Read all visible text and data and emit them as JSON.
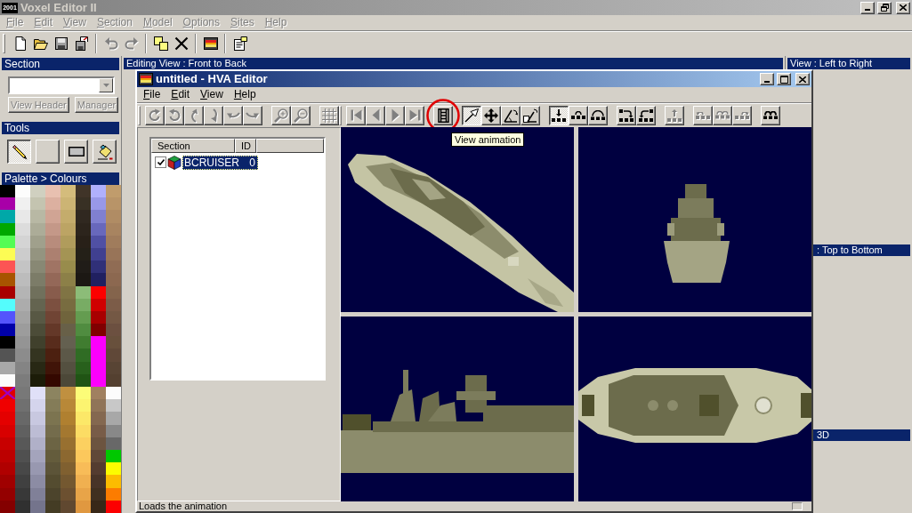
{
  "window": {
    "icon_text": "2001",
    "title": "Voxel Editor II"
  },
  "menu": [
    {
      "label": "File",
      "disabled": true
    },
    {
      "label": "Edit",
      "disabled": true
    },
    {
      "label": "View",
      "disabled": true
    },
    {
      "label": "Section",
      "disabled": true
    },
    {
      "label": "Model",
      "disabled": true
    },
    {
      "label": "Options",
      "disabled": true
    },
    {
      "label": "Sites",
      "disabled": true
    },
    {
      "label": "Help",
      "disabled": true
    }
  ],
  "toolbar": [
    {
      "kind": "new",
      "disabled": false
    },
    {
      "kind": "open",
      "disabled": false
    },
    {
      "kind": "save",
      "disabled": false
    },
    {
      "kind": "save_as",
      "disabled": false
    },
    {
      "kind": "separator"
    },
    {
      "kind": "undo",
      "disabled": true
    },
    {
      "kind": "redo",
      "disabled": true
    },
    {
      "kind": "separator"
    },
    {
      "kind": "copy",
      "disabled": false
    },
    {
      "kind": "delete",
      "disabled": false
    },
    {
      "kind": "separator"
    },
    {
      "kind": "hva",
      "disabled": false
    },
    {
      "kind": "separator"
    },
    {
      "kind": "properties",
      "disabled": false
    }
  ],
  "section_panel": {
    "title": "Section",
    "buttons": [
      {
        "label": "View Header",
        "disabled": true
      },
      {
        "label": "Manager",
        "disabled": true
      }
    ]
  },
  "tools_panel": {
    "title": "Tools",
    "tools": [
      {
        "kind": "pencil",
        "selected": true
      },
      {
        "kind": "blank",
        "selected": false
      },
      {
        "kind": "rectangle",
        "selected": false
      },
      {
        "kind": "fill",
        "selected": false
      }
    ]
  },
  "palette": {
    "title": "Palette > Colours",
    "columns": [
      [
        {
          "color": "#000000",
          "selected": false
        },
        {
          "color": "#a800a8",
          "selected": false
        },
        {
          "color": "#00a8a8",
          "selected": false
        },
        {
          "color": "#00a800",
          "selected": false
        },
        {
          "color": "#54fc54",
          "selected": false
        },
        {
          "color": "#fcfc54",
          "selected": false
        },
        {
          "color": "#fc5454",
          "selected": false
        },
        {
          "color": "#a85400",
          "selected": false
        },
        {
          "color": "#a80000",
          "selected": false
        },
        {
          "color": "#54fcfc",
          "selected": false
        },
        {
          "color": "#5454fc",
          "selected": false
        },
        {
          "color": "#0000a8",
          "selected": false
        },
        {
          "color": "#000000",
          "selected": false
        },
        {
          "color": "#545454",
          "selected": false
        },
        {
          "color": "#a8a8a8",
          "selected": false
        },
        {
          "color": "#fcfcfc",
          "selected": false
        },
        {
          "color": "#e00000",
          "selected": true
        },
        {
          "color": "#f00000",
          "selected": false
        },
        {
          "color": "#e40000",
          "selected": false
        },
        {
          "color": "#d80000",
          "selected": false
        },
        {
          "color": "#c80000",
          "selected": false
        },
        {
          "color": "#bc0000",
          "selected": false
        },
        {
          "color": "#b00000",
          "selected": false
        },
        {
          "color": "#a00000",
          "selected": false
        },
        {
          "color": "#940000",
          "selected": false
        },
        {
          "color": "#840000",
          "selected": false
        }
      ],
      [
        {
          "color": "#fcfcfc",
          "selected": false
        },
        {
          "color": "#f0f0f0",
          "selected": false
        },
        {
          "color": "#e8e8e8",
          "selected": false
        },
        {
          "color": "#dcdcdc",
          "selected": false
        },
        {
          "color": "#d4d4d4",
          "selected": false
        },
        {
          "color": "#cccccc",
          "selected": false
        },
        {
          "color": "#c4c4c4",
          "selected": false
        },
        {
          "color": "#bcbcbc",
          "selected": false
        },
        {
          "color": "#b4b4b4",
          "selected": false
        },
        {
          "color": "#acacac",
          "selected": false
        },
        {
          "color": "#a4a4a4",
          "selected": false
        },
        {
          "color": "#9c9c9c",
          "selected": false
        },
        {
          "color": "#949494",
          "selected": false
        },
        {
          "color": "#8c8c8c",
          "selected": false
        },
        {
          "color": "#848484",
          "selected": false
        },
        {
          "color": "#7c7c7c",
          "selected": false
        },
        {
          "color": "#787878",
          "selected": false
        },
        {
          "color": "#707070",
          "selected": false
        },
        {
          "color": "#686868",
          "selected": false
        },
        {
          "color": "#606060",
          "selected": false
        },
        {
          "color": "#585858",
          "selected": false
        },
        {
          "color": "#505050",
          "selected": false
        },
        {
          "color": "#484848",
          "selected": false
        },
        {
          "color": "#404040",
          "selected": false
        },
        {
          "color": "#383838",
          "selected": false
        },
        {
          "color": "#303030",
          "selected": false
        }
      ],
      [
        {
          "color": "#d0d0c0",
          "selected": false
        },
        {
          "color": "#c4c4b0",
          "selected": false
        },
        {
          "color": "#b8b8a4",
          "selected": false
        },
        {
          "color": "#acac98",
          "selected": false
        },
        {
          "color": "#a0a08c",
          "selected": false
        },
        {
          "color": "#949480",
          "selected": false
        },
        {
          "color": "#888874",
          "selected": false
        },
        {
          "color": "#7c7c68",
          "selected": false
        },
        {
          "color": "#70705c",
          "selected": false
        },
        {
          "color": "#646450",
          "selected": false
        },
        {
          "color": "#585844",
          "selected": false
        },
        {
          "color": "#4c4c38",
          "selected": false
        },
        {
          "color": "#40402c",
          "selected": false
        },
        {
          "color": "#343420",
          "selected": false
        },
        {
          "color": "#282814",
          "selected": false
        },
        {
          "color": "#1c1c08",
          "selected": false
        },
        {
          "color": "#e0e0f8",
          "selected": false
        },
        {
          "color": "#d4d4ec",
          "selected": false
        },
        {
          "color": "#c8c8e0",
          "selected": false
        },
        {
          "color": "#bcbcd4",
          "selected": false
        },
        {
          "color": "#b0b0c8",
          "selected": false
        },
        {
          "color": "#a4a4bc",
          "selected": false
        },
        {
          "color": "#9898b0",
          "selected": false
        },
        {
          "color": "#8c8ca4",
          "selected": false
        },
        {
          "color": "#808098",
          "selected": false
        },
        {
          "color": "#74748c",
          "selected": false
        }
      ],
      [
        {
          "color": "#e8c0b0",
          "selected": false
        },
        {
          "color": "#dcb0a0",
          "selected": false
        },
        {
          "color": "#d0a494",
          "selected": false
        },
        {
          "color": "#c49888",
          "selected": false
        },
        {
          "color": "#b88c7c",
          "selected": false
        },
        {
          "color": "#ac8070",
          "selected": false
        },
        {
          "color": "#a07464",
          "selected": false
        },
        {
          "color": "#946858",
          "selected": false
        },
        {
          "color": "#885c4c",
          "selected": false
        },
        {
          "color": "#7c5040",
          "selected": false
        },
        {
          "color": "#704434",
          "selected": false
        },
        {
          "color": "#643828",
          "selected": false
        },
        {
          "color": "#582c1c",
          "selected": false
        },
        {
          "color": "#4c2010",
          "selected": false
        },
        {
          "color": "#401408",
          "selected": false
        },
        {
          "color": "#340800",
          "selected": false
        },
        {
          "color": "#8c8460",
          "selected": false
        },
        {
          "color": "#847c58",
          "selected": false
        },
        {
          "color": "#7c7450",
          "selected": false
        },
        {
          "color": "#746c4c",
          "selected": false
        },
        {
          "color": "#6c6444",
          "selected": false
        },
        {
          "color": "#645c3c",
          "selected": false
        },
        {
          "color": "#5c5438",
          "selected": false
        },
        {
          "color": "#544c30",
          "selected": false
        },
        {
          "color": "#4c442c",
          "selected": false
        },
        {
          "color": "#443c24",
          "selected": false
        }
      ],
      [
        {
          "color": "#d4bc7c",
          "selected": false
        },
        {
          "color": "#ccb474",
          "selected": false
        },
        {
          "color": "#c4ac6c",
          "selected": false
        },
        {
          "color": "#bca464",
          "selected": false
        },
        {
          "color": "#b09c5c",
          "selected": false
        },
        {
          "color": "#a49454",
          "selected": false
        },
        {
          "color": "#988c4c",
          "selected": false
        },
        {
          "color": "#8c8048",
          "selected": false
        },
        {
          "color": "#807444",
          "selected": false
        },
        {
          "color": "#786c40",
          "selected": false
        },
        {
          "color": "#70643c",
          "selected": false
        },
        {
          "color": "#686048",
          "selected": false
        },
        {
          "color": "#646050",
          "selected": false
        },
        {
          "color": "#5c5848",
          "selected": false
        },
        {
          "color": "#545040",
          "selected": false
        },
        {
          "color": "#4c4838",
          "selected": false
        },
        {
          "color": "#c09040",
          "selected": false
        },
        {
          "color": "#b88838",
          "selected": false
        },
        {
          "color": "#b08030",
          "selected": false
        },
        {
          "color": "#a47830",
          "selected": false
        },
        {
          "color": "#987030",
          "selected": false
        },
        {
          "color": "#8c6830",
          "selected": false
        },
        {
          "color": "#806030",
          "selected": false
        },
        {
          "color": "#745830",
          "selected": false
        },
        {
          "color": "#6c5030",
          "selected": false
        },
        {
          "color": "#604830",
          "selected": false
        }
      ],
      [
        {
          "color": "#403428",
          "selected": false
        },
        {
          "color": "#383024",
          "selected": false
        },
        {
          "color": "#302820",
          "selected": false
        },
        {
          "color": "#2c241c",
          "selected": false
        },
        {
          "color": "#282018",
          "selected": false
        },
        {
          "color": "#242018",
          "selected": false
        },
        {
          "color": "#201c18",
          "selected": false
        },
        {
          "color": "#1c1814",
          "selected": false
        },
        {
          "color": "#8cbc78",
          "selected": false
        },
        {
          "color": "#78ac64",
          "selected": false
        },
        {
          "color": "#649c50",
          "selected": false
        },
        {
          "color": "#508c40",
          "selected": false
        },
        {
          "color": "#407c30",
          "selected": false
        },
        {
          "color": "#306c24",
          "selected": false
        },
        {
          "color": "#28601c",
          "selected": false
        },
        {
          "color": "#205414",
          "selected": false
        },
        {
          "color": "#fcfc78",
          "selected": false
        },
        {
          "color": "#fcf470",
          "selected": false
        },
        {
          "color": "#fce868",
          "selected": false
        },
        {
          "color": "#fcdc64",
          "selected": false
        },
        {
          "color": "#fcd060",
          "selected": false
        },
        {
          "color": "#fcc85c",
          "selected": false
        },
        {
          "color": "#f8bc58",
          "selected": false
        },
        {
          "color": "#f0b050",
          "selected": false
        },
        {
          "color": "#e8a448",
          "selected": false
        },
        {
          "color": "#e09840",
          "selected": false
        }
      ],
      [
        {
          "color": "#b0b0fc",
          "selected": false
        },
        {
          "color": "#9898e8",
          "selected": false
        },
        {
          "color": "#8080d0",
          "selected": false
        },
        {
          "color": "#6868bc",
          "selected": false
        },
        {
          "color": "#5050a4",
          "selected": false
        },
        {
          "color": "#404090",
          "selected": false
        },
        {
          "color": "#303078",
          "selected": false
        },
        {
          "color": "#202060",
          "selected": false
        },
        {
          "color": "#fc0000",
          "selected": false
        },
        {
          "color": "#d00000",
          "selected": false
        },
        {
          "color": "#a80000",
          "selected": false
        },
        {
          "color": "#800000",
          "selected": false
        },
        {
          "color": "#fc00fc",
          "selected": false
        },
        {
          "color": "#fc00fc",
          "selected": false
        },
        {
          "color": "#fc00fc",
          "selected": false
        },
        {
          "color": "#fc00fc",
          "selected": false
        },
        {
          "color": "#a08060",
          "selected": false
        },
        {
          "color": "#907458",
          "selected": false
        },
        {
          "color": "#846850",
          "selected": false
        },
        {
          "color": "#785c48",
          "selected": false
        },
        {
          "color": "#6c5440",
          "selected": false
        },
        {
          "color": "#604838",
          "selected": false
        },
        {
          "color": "#543c30",
          "selected": false
        },
        {
          "color": "#483428",
          "selected": false
        },
        {
          "color": "#403020",
          "selected": false
        },
        {
          "color": "#382818",
          "selected": false
        }
      ],
      [
        {
          "color": "#c09c6c",
          "selected": false
        },
        {
          "color": "#b89468",
          "selected": false
        },
        {
          "color": "#b08c64",
          "selected": false
        },
        {
          "color": "#a88460",
          "selected": false
        },
        {
          "color": "#a07c5c",
          "selected": false
        },
        {
          "color": "#987458",
          "selected": false
        },
        {
          "color": "#906c54",
          "selected": false
        },
        {
          "color": "#8c6850",
          "selected": false
        },
        {
          "color": "#84644c",
          "selected": false
        },
        {
          "color": "#7c5c48",
          "selected": false
        },
        {
          "color": "#745844",
          "selected": false
        },
        {
          "color": "#6c5040",
          "selected": false
        },
        {
          "color": "#68503c",
          "selected": false
        },
        {
          "color": "#604838",
          "selected": false
        },
        {
          "color": "#584434",
          "selected": false
        },
        {
          "color": "#544030",
          "selected": false
        },
        {
          "color": "#fcfcfc",
          "selected": false
        },
        {
          "color": "#c8c8c8",
          "selected": false
        },
        {
          "color": "#a8a8a8",
          "selected": false
        },
        {
          "color": "#888888",
          "selected": false
        },
        {
          "color": "#686868",
          "selected": false
        },
        {
          "color": "#00c800",
          "selected": false
        },
        {
          "color": "#fcfc00",
          "selected": false
        },
        {
          "color": "#fcbc00",
          "selected": false
        },
        {
          "color": "#fc7c00",
          "selected": false
        },
        {
          "color": "#fc0000",
          "selected": false
        }
      ]
    ]
  },
  "editing_view": {
    "title": "Editing View : Front to Back"
  },
  "side_views": [
    {
      "title": "View : Left to Right"
    },
    {
      "title": ": Top to Bottom"
    },
    {
      "title": "3D"
    }
  ],
  "hva_editor": {
    "title": "untitled - HVA Editor",
    "menu": [
      "File",
      "Edit",
      "View",
      "Help"
    ],
    "toolbar": [
      {
        "kind": "grip"
      },
      {
        "kind": "rotate_cw",
        "disabled": true,
        "pressed": false,
        "highlighted": false
      },
      {
        "kind": "rotate_ccw",
        "disabled": true,
        "pressed": false,
        "highlighted": false
      },
      {
        "kind": "tilt_up",
        "disabled": true,
        "pressed": false,
        "highlighted": false
      },
      {
        "kind": "tilt_down",
        "disabled": true,
        "pressed": false,
        "highlighted": false
      },
      {
        "kind": "turn_left",
        "disabled": true,
        "pressed": false,
        "highlighted": false
      },
      {
        "kind": "turn_right",
        "disabled": true,
        "pressed": false,
        "highlighted": false
      },
      {
        "kind": "gap"
      },
      {
        "kind": "zoom_in",
        "disabled": true,
        "pressed": false,
        "highlighted": false
      },
      {
        "kind": "zoom_out",
        "disabled": true,
        "pressed": false,
        "highlighted": false
      },
      {
        "kind": "gap"
      },
      {
        "kind": "grid",
        "disabled": true,
        "pressed": false,
        "highlighted": false
      },
      {
        "kind": "grip"
      },
      {
        "kind": "first",
        "disabled": true,
        "pressed": false,
        "highlighted": false
      },
      {
        "kind": "previous",
        "disabled": true,
        "pressed": false,
        "highlighted": false
      },
      {
        "kind": "next",
        "disabled": true,
        "pressed": false,
        "highlighted": false
      },
      {
        "kind": "last",
        "disabled": true,
        "pressed": false,
        "highlighted": false
      },
      {
        "kind": "gap"
      },
      {
        "kind": "animation",
        "disabled": false,
        "pressed": false,
        "highlighted": true
      },
      {
        "kind": "gap"
      },
      {
        "kind": "select",
        "disabled": false,
        "pressed": true,
        "highlighted": false
      },
      {
        "kind": "move",
        "disabled": false,
        "pressed": false,
        "highlighted": false
      },
      {
        "kind": "angle",
        "disabled": false,
        "pressed": false,
        "highlighted": false
      },
      {
        "kind": "angle_edit",
        "disabled": false,
        "pressed": false,
        "highlighted": false
      },
      {
        "kind": "gap"
      },
      {
        "kind": "blocks_down",
        "disabled": false,
        "pressed": true,
        "highlighted": false
      },
      {
        "kind": "blocks_arc",
        "disabled": false,
        "pressed": false,
        "highlighted": false
      },
      {
        "kind": "blocks_arcs",
        "disabled": false,
        "pressed": false,
        "highlighted": false
      },
      {
        "kind": "gap"
      },
      {
        "kind": "blocks_turn_right",
        "disabled": false,
        "pressed": false,
        "highlighted": false
      },
      {
        "kind": "blocks_turn_left",
        "disabled": false,
        "pressed": false,
        "highlighted": false
      },
      {
        "kind": "gap"
      },
      {
        "kind": "blocks_up",
        "disabled": true,
        "pressed": false,
        "highlighted": false
      },
      {
        "kind": "gap"
      },
      {
        "kind": "blocks_arc_left",
        "disabled": true,
        "pressed": false,
        "highlighted": false
      },
      {
        "kind": "blocks_arc_double",
        "disabled": true,
        "pressed": false,
        "highlighted": false
      },
      {
        "kind": "blocks_arc_right",
        "disabled": true,
        "pressed": false,
        "highlighted": false
      },
      {
        "kind": "gap"
      },
      {
        "kind": "blocks_bridge",
        "disabled": false,
        "pressed": false,
        "highlighted": false
      }
    ],
    "tooltip": "View animation",
    "section_list": {
      "columns": [
        "Section",
        "ID"
      ],
      "rows": [
        {
          "checked": true,
          "name": "BCRUISER",
          "id": "0",
          "selected": true
        }
      ]
    },
    "views": [
      {
        "kind": "perspective"
      },
      {
        "kind": "front"
      },
      {
        "kind": "side"
      },
      {
        "kind": "top"
      }
    ],
    "status_bar": "Loads the animation"
  }
}
